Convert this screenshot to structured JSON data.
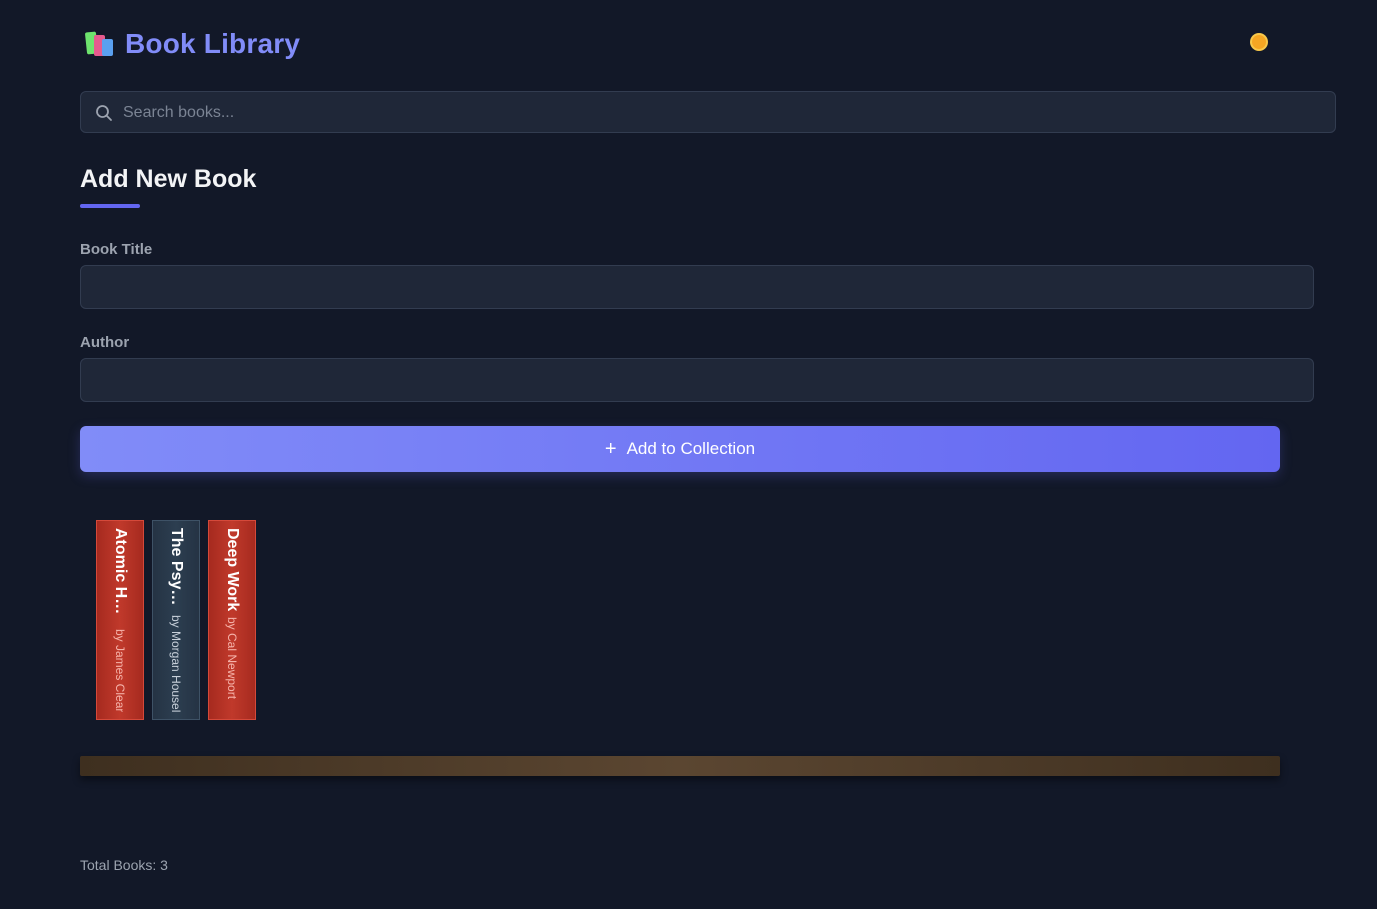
{
  "header": {
    "title": "Book Library",
    "logo_icon": "books-icon",
    "theme_toggle_icon": "sun-icon"
  },
  "search": {
    "placeholder": "Search books...",
    "value": ""
  },
  "add_form": {
    "heading": "Add New Book",
    "title_label": "Book Title",
    "title_value": "",
    "author_label": "Author",
    "author_value": "",
    "submit_label": "Add to Collection",
    "accent_color": "#6366f1"
  },
  "books": [
    {
      "title": "Atomic Habits",
      "author": "by James Clear",
      "color": "#c0392b"
    },
    {
      "title": "The Psychology of M...",
      "author": "by Morgan Housel",
      "color": "#2c3e50"
    },
    {
      "title": "Deep Work",
      "author": "by Cal Newport",
      "color": "#c0392b"
    }
  ],
  "footer": {
    "total_label": "Total Books: 3"
  }
}
